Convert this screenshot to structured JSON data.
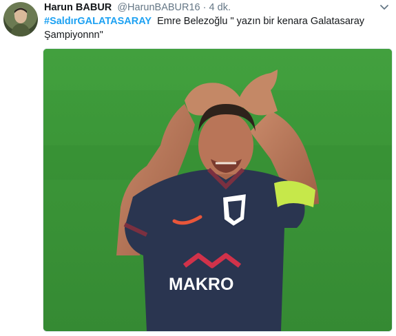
{
  "tweet": {
    "author_name": "Harun BABUR",
    "author_handle": "@HarunBABUR16",
    "separator": "·",
    "timestamp": "4 dk.",
    "hashtag": "#SaldırGALATASARAY",
    "text": "Emre Belezoğlu \" yazın bir kenara Galatasaray Şampiyonnn\"",
    "jersey_sponsor": "MAKRO"
  },
  "colors": {
    "hashtag": "#1da1f2",
    "meta": "#657786",
    "pitch": "#3d9a3a",
    "jersey": "#2a3550",
    "armband": "#c6e84a"
  },
  "icons": {
    "menu": "chevron-down-icon"
  }
}
